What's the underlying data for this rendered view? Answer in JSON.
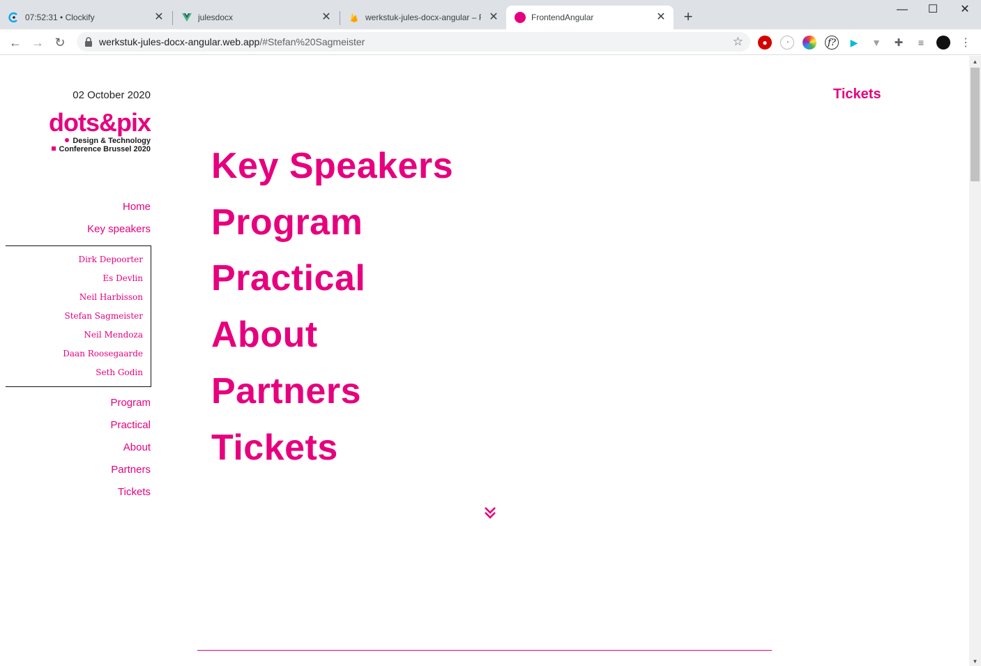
{
  "browser": {
    "tabs": [
      {
        "title": "07:52:31 • Clockify",
        "favicon": "clockify-icon"
      },
      {
        "title": "julesdocx",
        "favicon": "vue-icon"
      },
      {
        "title": "werkstuk-jules-docx-angular – Fi",
        "favicon": "firebase-icon"
      },
      {
        "title": "FrontendAngular",
        "favicon": "pink-dot-icon",
        "active": true
      }
    ],
    "url_domain": "werkstuk-jules-docx-angular.web.app",
    "url_path": "/#Stefan%20Sagmeister",
    "window_controls": [
      "minimize",
      "maximize",
      "close"
    ]
  },
  "site": {
    "date": "02 October 2020",
    "logo": {
      "wordmark": "dots&pix",
      "line1": "Design & Technology",
      "line2": "Conference Brussel 2020"
    },
    "nav": {
      "home": "Home",
      "key_speakers": "Key speakers",
      "speakers": [
        "Dirk Depoorter",
        "Es Devlin",
        "Neil Harbisson",
        "Stefan Sagmeister",
        "Neil Mendoza",
        "Daan Roosegaarde",
        "Seth Godin"
      ],
      "program": "Program",
      "practical": "Practical",
      "about": "About",
      "partners": "Partners",
      "tickets": "Tickets"
    },
    "top_link": "Tickets",
    "hero_items": [
      "Key Speakers",
      "Program",
      "Practical",
      "About",
      "Partners",
      "Tickets"
    ],
    "colors": {
      "accent": "#e6007e"
    }
  }
}
